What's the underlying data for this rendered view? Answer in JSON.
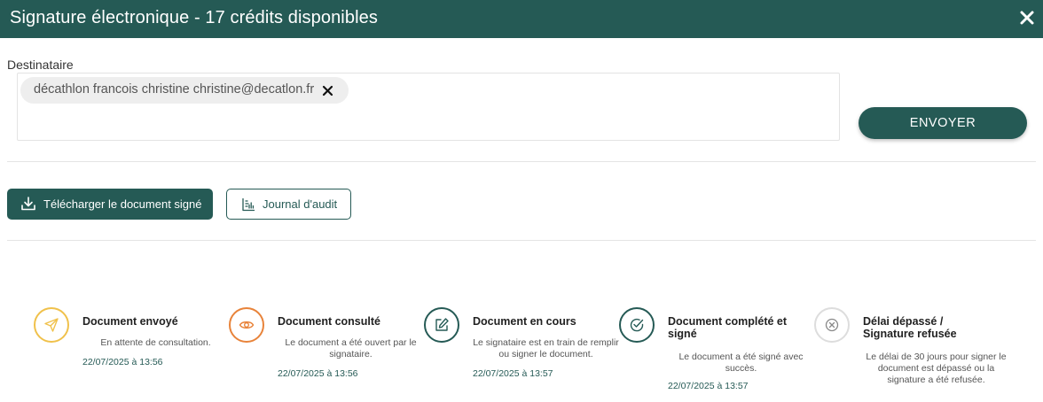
{
  "window": {
    "title": "Signature électronique - 17 crédits disponibles",
    "close_icon": "close-icon"
  },
  "recipient": {
    "label": "Destinataire",
    "chip_text": "décathlon francois christine christine@decatlon.fr",
    "chip_remove_icon": "close-icon"
  },
  "actions": {
    "send_label": "ENVOYER",
    "download_label": "Télécharger le document signé",
    "download_icon": "download-icon",
    "audit_label": "Journal d'audit",
    "audit_icon": "audit-log-icon"
  },
  "colors": {
    "brand": "#255a55",
    "sent": "#f0c14b",
    "viewed": "#e8833a",
    "in_progress": "#255a55",
    "completed": "#255a55",
    "expired": "#bbbbbb"
  },
  "timeline": [
    {
      "icon": "send-icon",
      "title": "Document envoyé",
      "description": "En attente de consultation.",
      "date": "22/07/2025 à 13:56"
    },
    {
      "icon": "eye-icon",
      "title": "Document consulté",
      "description": "Le document a été ouvert par le signataire.",
      "date": "22/07/2025 à 13:56"
    },
    {
      "icon": "edit-icon",
      "title": "Document en cours",
      "description": "Le signataire est en train de remplir ou signer le document.",
      "date": "22/07/2025 à 13:57"
    },
    {
      "icon": "check-circle-icon",
      "title": "Document complété et signé",
      "description": "Le document a été signé avec succès.",
      "date": "22/07/2025 à 13:57"
    },
    {
      "icon": "cancel-circle-icon",
      "title": "Délai dépassé / Signature refusée",
      "description": "Le délai de 30 jours pour signer le document est dépassé ou la signature a été refusée.",
      "date": ""
    }
  ]
}
